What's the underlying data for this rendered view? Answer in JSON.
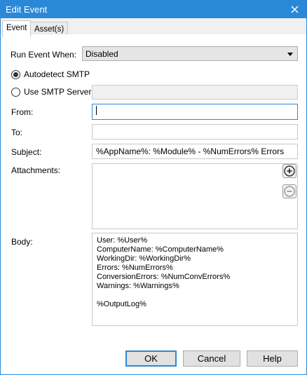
{
  "window": {
    "title": "Edit Event"
  },
  "tabs": [
    {
      "label": "Event",
      "active": true
    },
    {
      "label": "Asset(s)",
      "active": false
    }
  ],
  "form": {
    "run_event_label": "Run Event When:",
    "run_event_value": "Disabled",
    "autodetect_label": "Autodetect SMTP",
    "use_smtp_label": "Use SMTP Server:",
    "smtp_server_value": "",
    "from_label": "From:",
    "from_value": "",
    "to_label": "To:",
    "to_value": "",
    "subject_label": "Subject:",
    "subject_value": "%AppName%: %Module% - %NumErrors% Errors",
    "attachments_label": "Attachments:",
    "body_label": "Body:",
    "body_value": "User: %User%\nComputerName: %ComputerName%\nWorkingDir: %WorkingDir%\nErrors: %NumErrors%\nConversionErrors: %NumConvErrors%\nWarnings: %Warnings%\n\n%OutputLog%",
    "selected_smtp_option": "autodetect"
  },
  "buttons": {
    "ok": "OK",
    "cancel": "Cancel",
    "help": "Help"
  },
  "colors": {
    "accent": "#2b88d8"
  }
}
